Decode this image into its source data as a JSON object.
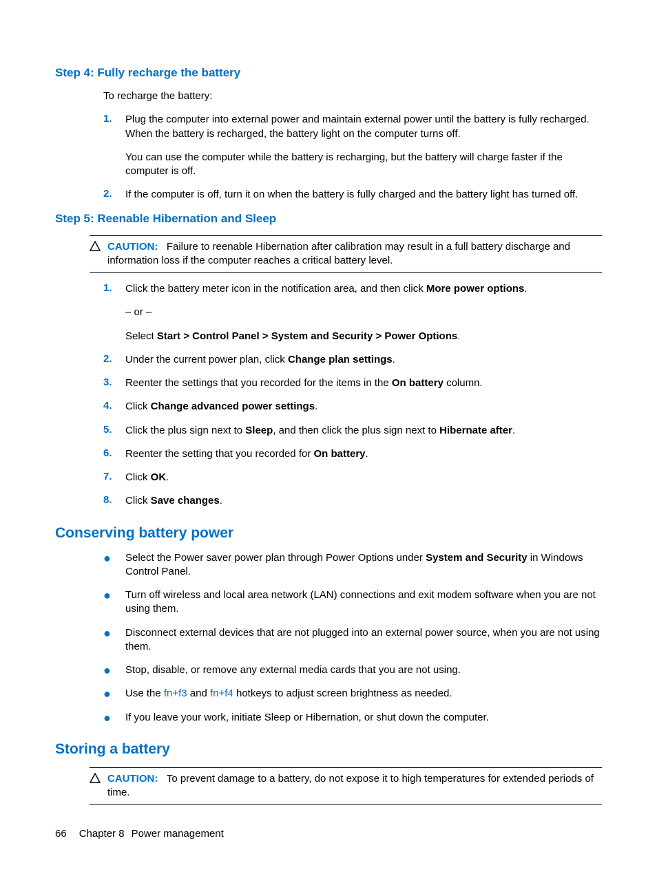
{
  "step4": {
    "heading": "Step 4: Fully recharge the battery",
    "intro": "To recharge the battery:",
    "item1_a": "Plug the computer into external power and maintain external power until the battery is fully recharged. When the battery is recharged, the battery light on the computer turns off.",
    "item1_b": "You can use the computer while the battery is recharging, but the battery will charge faster if the computer is off.",
    "item2": "If the computer is off, turn it on when the battery is fully charged and the battery light has turned off.",
    "n1": "1.",
    "n2": "2."
  },
  "step5": {
    "heading": "Step 5: Reenable Hibernation and Sleep",
    "caution_label": "CAUTION:",
    "caution_text": "Failure to reenable Hibernation after calibration may result in a full battery discharge and information loss if the computer reaches a critical battery level.",
    "n1": "1.",
    "n2": "2.",
    "n3": "3.",
    "n4": "4.",
    "n5": "5.",
    "n6": "6.",
    "n7": "7.",
    "n8": "8.",
    "i1_a": "Click the battery meter icon in the notification area, and then click ",
    "i1_bold": "More power options",
    "i1_c": ".",
    "i1_or": "– or –",
    "i1_sel_a": "Select ",
    "i1_sel_bold": "Start > Control Panel > System and Security > Power Options",
    "i1_sel_c": ".",
    "i2_a": "Under the current power plan, click ",
    "i2_bold": "Change plan settings",
    "i2_c": ".",
    "i3_a": "Reenter the settings that you recorded for the items in the ",
    "i3_bold": "On battery",
    "i3_c": " column.",
    "i4_a": "Click ",
    "i4_bold": "Change advanced power settings",
    "i4_c": ".",
    "i5_a": "Click the plus sign next to ",
    "i5_bold1": "Sleep",
    "i5_b": ", and then click the plus sign next to ",
    "i5_bold2": "Hibernate after",
    "i5_c": ".",
    "i6_a": "Reenter the setting that you recorded for ",
    "i6_bold": "On battery",
    "i6_c": ".",
    "i7_a": "Click ",
    "i7_bold": "OK",
    "i7_c": ".",
    "i8_a": "Click ",
    "i8_bold": "Save changes",
    "i8_c": "."
  },
  "conserve": {
    "heading": "Conserving battery power",
    "b1_a": "Select the Power saver power plan through Power Options under ",
    "b1_bold": "System and Security",
    "b1_c": " in Windows Control Panel.",
    "b2": "Turn off wireless and local area network (LAN) connections and exit modem software when you are not using them.",
    "b3": "Disconnect external devices that are not plugged into an external power source, when you are not using them.",
    "b4": "Stop, disable, or remove any external media cards that you are not using.",
    "b5_a": "Use the ",
    "b5_link1": "fn+f3",
    "b5_b": " and ",
    "b5_link2": "fn+f4",
    "b5_c": " hotkeys to adjust screen brightness as needed.",
    "b6": "If you leave your work, initiate Sleep or Hibernation, or shut down the computer."
  },
  "storing": {
    "heading": "Storing a battery",
    "caution_label": "CAUTION:",
    "caution_text": "To prevent damage to a battery, do not expose it to high temperatures for extended periods of time."
  },
  "footer": {
    "page": "66",
    "chapter": "Chapter 8",
    "title": "Power management"
  }
}
